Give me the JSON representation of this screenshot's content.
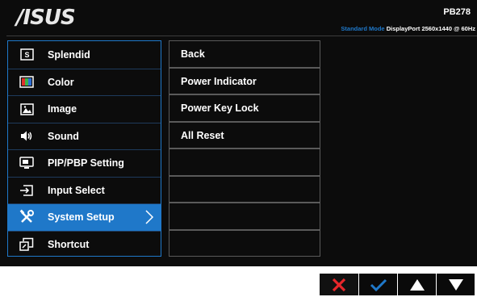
{
  "header": {
    "brand": "/ISUS",
    "model": "PB278",
    "mode_label": "Standard Mode",
    "input_label": "DisplayPort",
    "resolution_label": "2560x1440 @ 60Hz"
  },
  "menu": {
    "items": [
      {
        "label": "Splendid",
        "icon": "splendid-icon"
      },
      {
        "label": "Color",
        "icon": "color-icon"
      },
      {
        "label": "Image",
        "icon": "image-icon"
      },
      {
        "label": "Sound",
        "icon": "speaker-icon"
      },
      {
        "label": "PIP/PBP Setting",
        "icon": "pip-icon"
      },
      {
        "label": "Input Select",
        "icon": "input-select-icon"
      },
      {
        "label": "System Setup",
        "icon": "tools-icon",
        "selected": true
      },
      {
        "label": "Shortcut",
        "icon": "shortcut-icon"
      }
    ]
  },
  "submenu": {
    "items": [
      "Back",
      "Power Indicator",
      "Power Key Lock",
      "All Reset",
      "",
      "",
      "",
      ""
    ]
  },
  "keys": {
    "items": [
      "close-icon",
      "check-icon",
      "up-arrow-icon",
      "down-arrow-icon"
    ],
    "close_color": "#e8272b",
    "check_color": "#1f78c9"
  },
  "colors": {
    "accent": "#1f78c9",
    "osd_background": "#0c0c0c"
  }
}
